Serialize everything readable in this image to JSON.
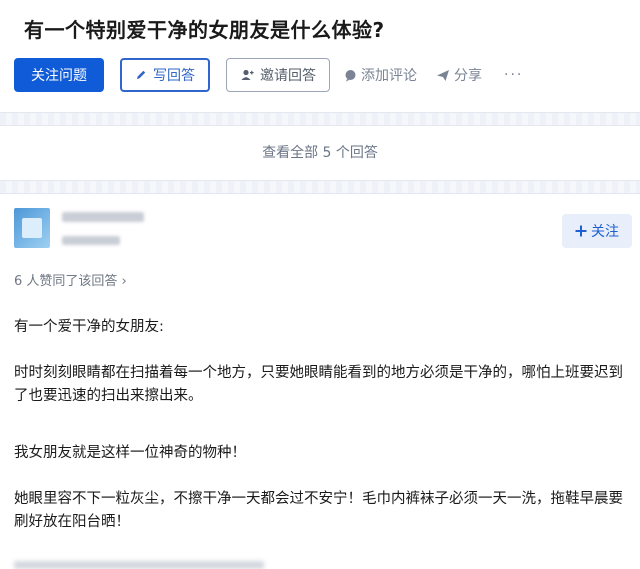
{
  "question": {
    "title": "有一个特别爱干净的女朋友是什么体验?"
  },
  "actions": {
    "follow_question": "关注问题",
    "write_answer": "写回答",
    "invite_answer": "邀请回答",
    "add_comment": "添加评论",
    "share": "分享",
    "more": "···"
  },
  "answers_summary": {
    "view_all": "查看全部 5 个回答"
  },
  "answer": {
    "follow_button": "关注",
    "voters_text": "6 人赞同了该回答 ›",
    "paragraphs": [
      "有一个爱干净的女朋友:",
      "时时刻刻眼睛都在扫描着每一个地方，只要她眼睛能看到的地方必须是干净的，哪怕上班要迟到了也要迅速的扫出来擦出来。",
      "我女朋友就是这样一位神奇的物种！",
      "她眼里容不下一粒灰尘，不擦干净一天都会过不安宁！毛巾内裤袜子必须一天一洗，拖鞋早晨要刷好放在阳台晒！"
    ]
  },
  "colors": {
    "primary": "#0f5bd8",
    "accent_text": "#2f66c9",
    "muted": "#7a8494"
  },
  "icons": [
    "pencil-icon",
    "user-plus-icon",
    "comment-icon",
    "share-icon",
    "plus-icon"
  ]
}
